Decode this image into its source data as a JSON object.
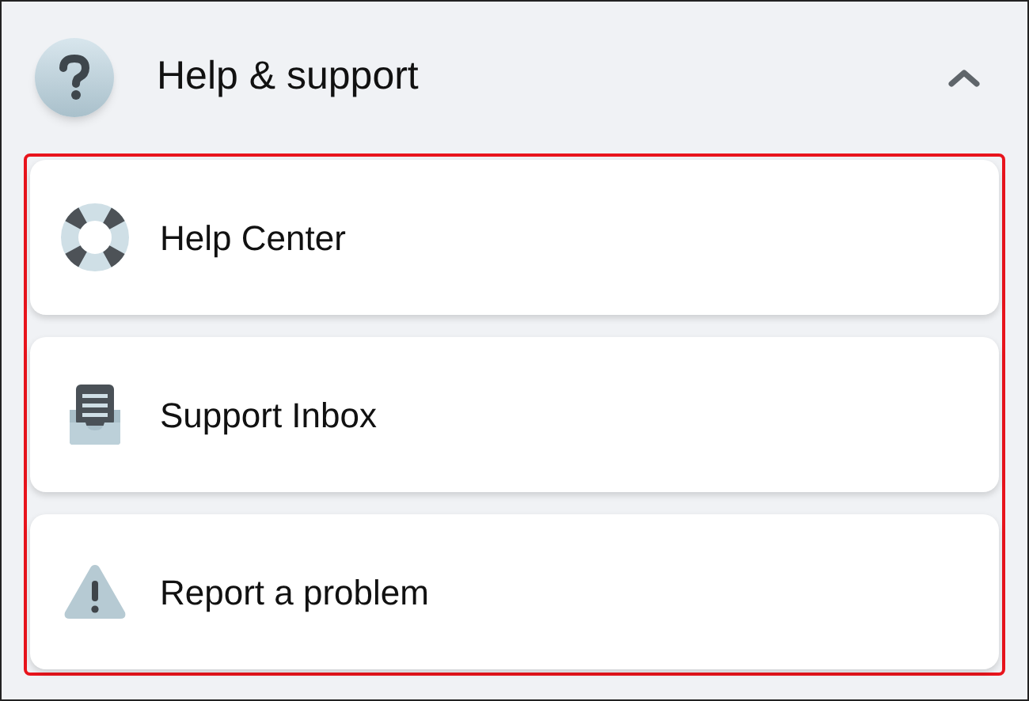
{
  "section": {
    "title": "Help & support",
    "expanded": true
  },
  "items": [
    {
      "kind": "lifebuoy",
      "label": "Help Center"
    },
    {
      "kind": "inbox",
      "label": "Support Inbox"
    },
    {
      "kind": "warning",
      "label": "Report a problem"
    }
  ],
  "highlight": true
}
